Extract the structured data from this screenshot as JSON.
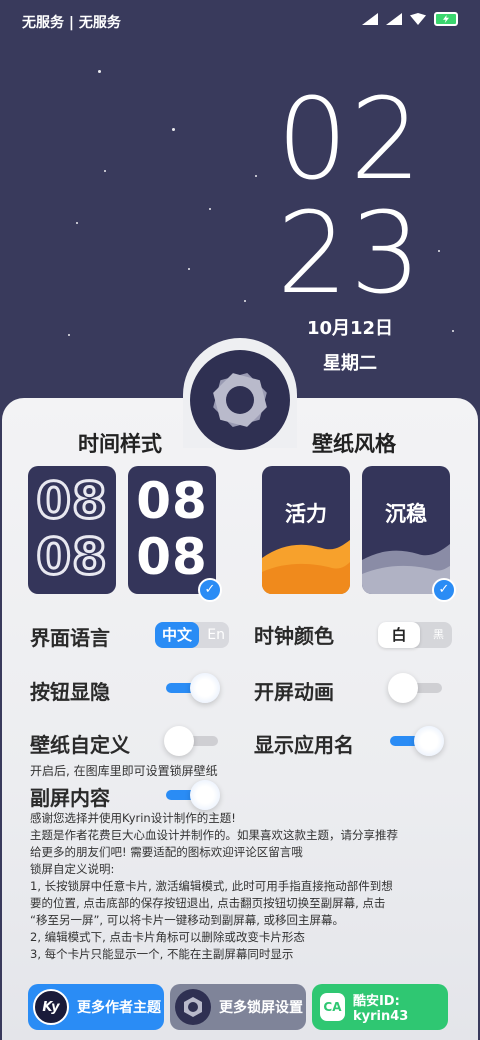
{
  "status_bar": {
    "carrier": "无服务 | 无服务"
  },
  "clock": {
    "hour": "02",
    "minute": "23",
    "date": "10月12日",
    "weekday": "星期二"
  },
  "time_style": {
    "title": "时间样式",
    "option1": {
      "line1": "08",
      "line2": "08"
    },
    "option2": {
      "line1": "08",
      "line2": "08"
    }
  },
  "wallpaper_style": {
    "title": "壁纸风格",
    "option1": "活力",
    "option2": "沉稳"
  },
  "settings": {
    "language_label": "界面语言",
    "language_on": "中文",
    "language_off": "En",
    "clock_color_label": "时钟颜色",
    "clock_color_on": "白",
    "clock_color_off": "黑",
    "button_visibility_label": "按钮显隐",
    "boot_animation_label": "开屏动画",
    "wallpaper_custom_label": "壁纸自定义",
    "show_app_name_label": "显示应用名",
    "wallpaper_hint": "开启后, 在图库里即可设置锁屏壁纸",
    "secondary_screen_label": "副屏内容"
  },
  "toggles": {
    "button_visibility": true,
    "boot_animation": false,
    "wallpaper_custom": false,
    "show_app_name": true,
    "secondary_screen": true
  },
  "description": [
    "感谢您选择并使用Kyrin设计制作的主题!",
    "主题是作者花费巨大心血设计并制作的。如果喜欢这款主题，请分享推荐",
    "给更多的朋友们吧! 需要适配的图标欢迎评论区留言哦",
    "锁屏自定义说明:",
    "1, 长按锁屏中任意卡片, 激活编辑模式, 此时可用手指直接拖动部件到想",
    "要的位置, 点击底部的保存按钮退出, 点击翻页按钮切换至副屏幕, 点击",
    "“移至另一屏”, 可以将卡片一键移动到副屏幕, 或移回主屏幕。",
    "2, 编辑模式下, 点击卡片角标可以删除或改变卡片形态",
    "3, 每个卡片只能显示一个, 不能在主副屏幕同时显示"
  ],
  "buttons": {
    "more_themes": "更多作者主题",
    "more_lockscreen": "更多锁屏设置",
    "coolapk": "酷安ID: kyrin43"
  },
  "colors": {
    "accent": "#2a8cf5",
    "background": "#393a5c",
    "coolapk": "#2fc772"
  }
}
